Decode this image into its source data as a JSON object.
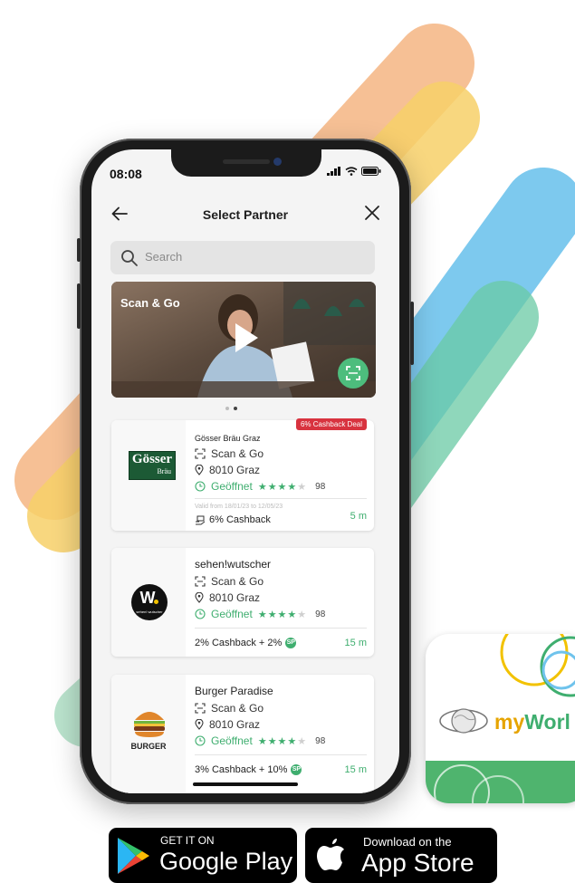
{
  "colors": {
    "accent_green": "#3fae6f",
    "deal_red": "#d8333f",
    "stripe_orange": "#f5b98a",
    "stripe_yellow": "#f7d068",
    "stripe_blue": "#6fc3ec",
    "stripe_teal": "#6ac9a4"
  },
  "status_bar": {
    "time": "08:08"
  },
  "header": {
    "title": "Select Partner",
    "back_icon": "arrow-left-icon",
    "close_icon": "close-icon"
  },
  "search": {
    "placeholder": "Search"
  },
  "hero": {
    "label": "Scan & Go",
    "slide_index": 2,
    "slide_count": 2
  },
  "partners": [
    {
      "name": "Gösser Bräu Graz",
      "logo_text": "Gösser",
      "logo_sub": "Bräu",
      "service": "Scan & Go",
      "address": "8010 Graz",
      "status": "Geöffnet",
      "rating": 4,
      "rating_count": "98",
      "deal_badge": "6% Cashback Deal",
      "valid_text": "Valid from 18/01/23 to 12/05/23",
      "cashback": "6% Cashback",
      "distance": "5 m"
    },
    {
      "name": "sehen!wutscher",
      "logo_text": "W.",
      "logo_sub": "sehen! wutscher",
      "service": "Scan & Go",
      "address": "8010 Graz",
      "status": "Geöffnet",
      "rating": 4,
      "rating_count": "98",
      "cashback": "2% Cashback + 2%",
      "sp_badge": "SP",
      "distance": "15 m"
    },
    {
      "name": "Burger Paradise",
      "logo_text": "BURGER",
      "service": "Scan & Go",
      "address": "8010 Graz",
      "status": "Geöffnet",
      "rating": 4,
      "rating_count": "98",
      "cashback": "3% Cashback + 10%",
      "sp_badge": "SP",
      "distance": "15 m"
    }
  ],
  "app_tile": {
    "brand_prefix": "my",
    "brand_rest": "Worl"
  },
  "store_badges": {
    "google": {
      "small": "GET IT ON",
      "big": "Google Play"
    },
    "apple": {
      "small": "Download on the",
      "big": "App Store"
    }
  }
}
